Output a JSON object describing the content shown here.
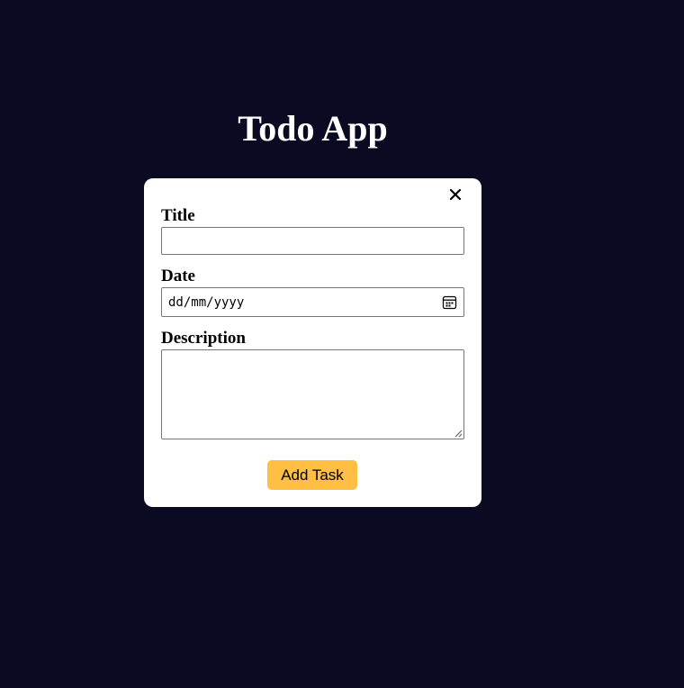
{
  "app": {
    "title": "Todo App"
  },
  "form": {
    "close_icon": "close-icon",
    "title_label": "Title",
    "title_value": "",
    "date_label": "Date",
    "date_placeholder": "dd/mm/yyyy",
    "date_icon": "calendar-icon",
    "description_label": "Description",
    "description_value": "",
    "submit_label": "Add Task"
  },
  "colors": {
    "background": "#0a0a23",
    "card": "#ffffff",
    "button": "#febf43"
  }
}
